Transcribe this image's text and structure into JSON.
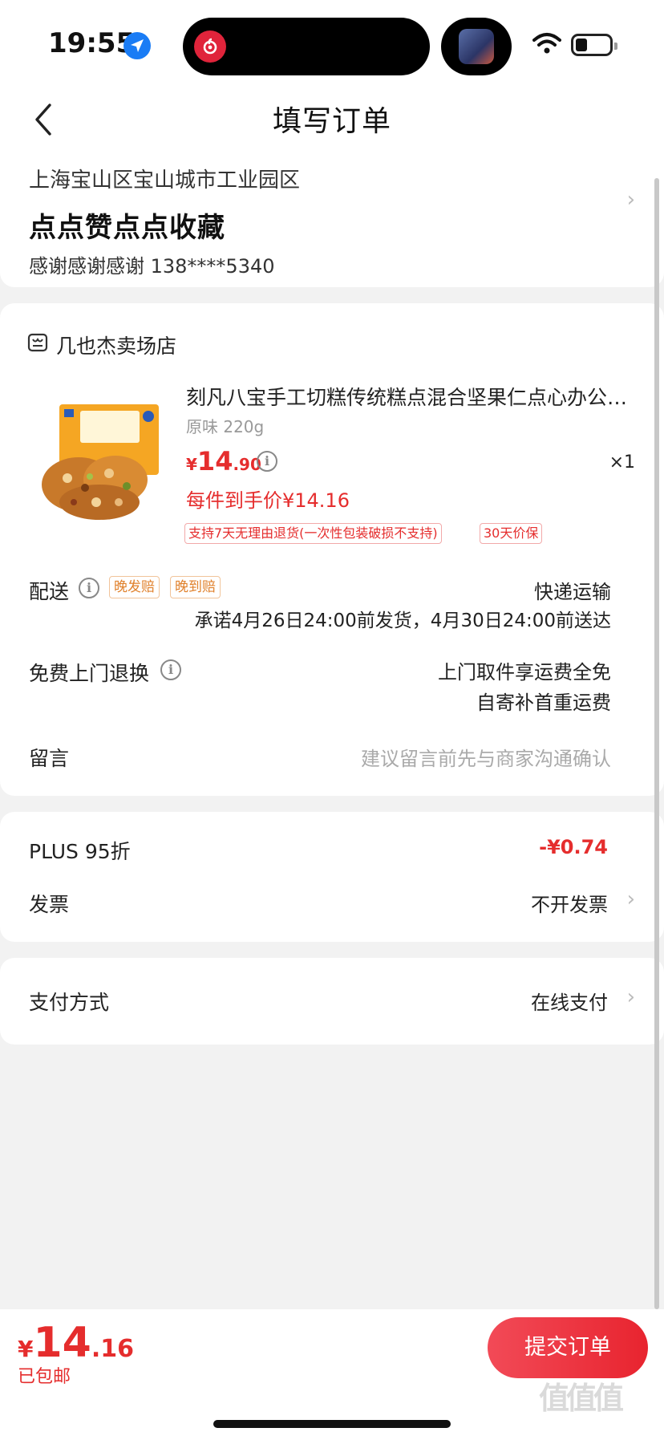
{
  "status": {
    "time": "19:55"
  },
  "nav": {
    "title": "填写订单"
  },
  "address": {
    "line": "上海宝山区宝山城市工业园区",
    "name": "点点赞点点收藏",
    "contact": "感谢感谢感谢  138****5340"
  },
  "shop": {
    "name": "几也杰卖场店"
  },
  "product": {
    "title": "刻凡八宝手工切糕传统糕点混合坚果仁点心办公室零食",
    "spec": "原味 220g",
    "price_currency": "¥",
    "price_int": "14",
    "price_dec": ".90",
    "qty": "×1",
    "unit_price": "每件到手价¥14.16",
    "tags": [
      "支持7天无理由退货(一次性包装破损不支持)",
      "30天价保"
    ]
  },
  "delivery": {
    "label": "配送",
    "badges": [
      "晚发赔",
      "晚到赔"
    ],
    "method": "快递运输",
    "promise": "承诺4月26日24:00前发货，4月30日24:00前送达"
  },
  "returns": {
    "label": "免费上门退换",
    "line1": "上门取件享运费全免",
    "line2": "自寄补首重运费"
  },
  "message": {
    "label": "留言",
    "placeholder": "建议留言前先与商家沟通确认"
  },
  "discount": {
    "label": "PLUS 95折",
    "value": "-¥0.74"
  },
  "invoice": {
    "label": "发票",
    "value": "不开发票"
  },
  "payment": {
    "label": "支付方式",
    "value": "在线支付"
  },
  "footer": {
    "total_currency": "¥",
    "total_int": "14",
    "total_dec": ".16",
    "shipping": "已包邮",
    "submit": "提交订单"
  },
  "watermark": "值值值",
  "colors": {
    "accent": "#e52d2d",
    "badge": "#e0812c",
    "background": "#f2f2f2"
  }
}
